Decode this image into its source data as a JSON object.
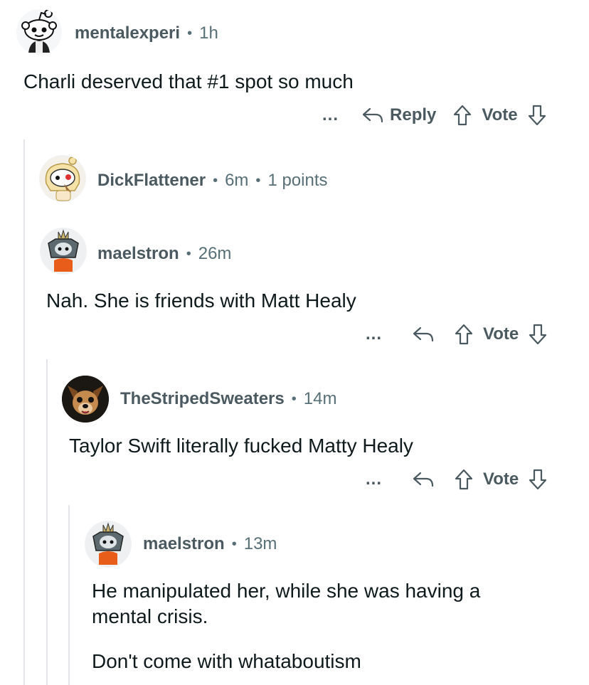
{
  "comments": [
    {
      "username": "mentalexperi",
      "time": "1h",
      "body": "Charli deserved that #1 spot so much",
      "actions": {
        "more": "...",
        "reply": "Reply",
        "vote": "Vote"
      }
    },
    {
      "username": "DickFlattener",
      "time": "6m",
      "points": "1 points"
    },
    {
      "username": "maelstron",
      "time": "26m",
      "body": "Nah. She is friends with Matt Healy",
      "actions": {
        "more": "...",
        "vote": "Vote"
      }
    },
    {
      "username": "TheStripedSweaters",
      "time": "14m",
      "body": "Taylor Swift literally fucked Matty Healy",
      "actions": {
        "more": "...",
        "vote": "Vote"
      }
    },
    {
      "username": "maelstron",
      "time": "13m",
      "body_lines": [
        "He manipulated her, while she was having a",
        "mental crisis."
      ],
      "body2": "Don't come with whataboutism"
    }
  ],
  "separator": "•",
  "icons": {
    "avatar_1": "snoo-avatar-icon",
    "avatar_2": "blonde-snoo-avatar-icon",
    "avatar_3": "armored-snoo-avatar-icon",
    "avatar_4": "chihuahua-photo-avatar-icon",
    "reply": "reply-arrow-icon",
    "upvote": "upvote-arrow-icon",
    "downvote": "downvote-arrow-icon"
  }
}
